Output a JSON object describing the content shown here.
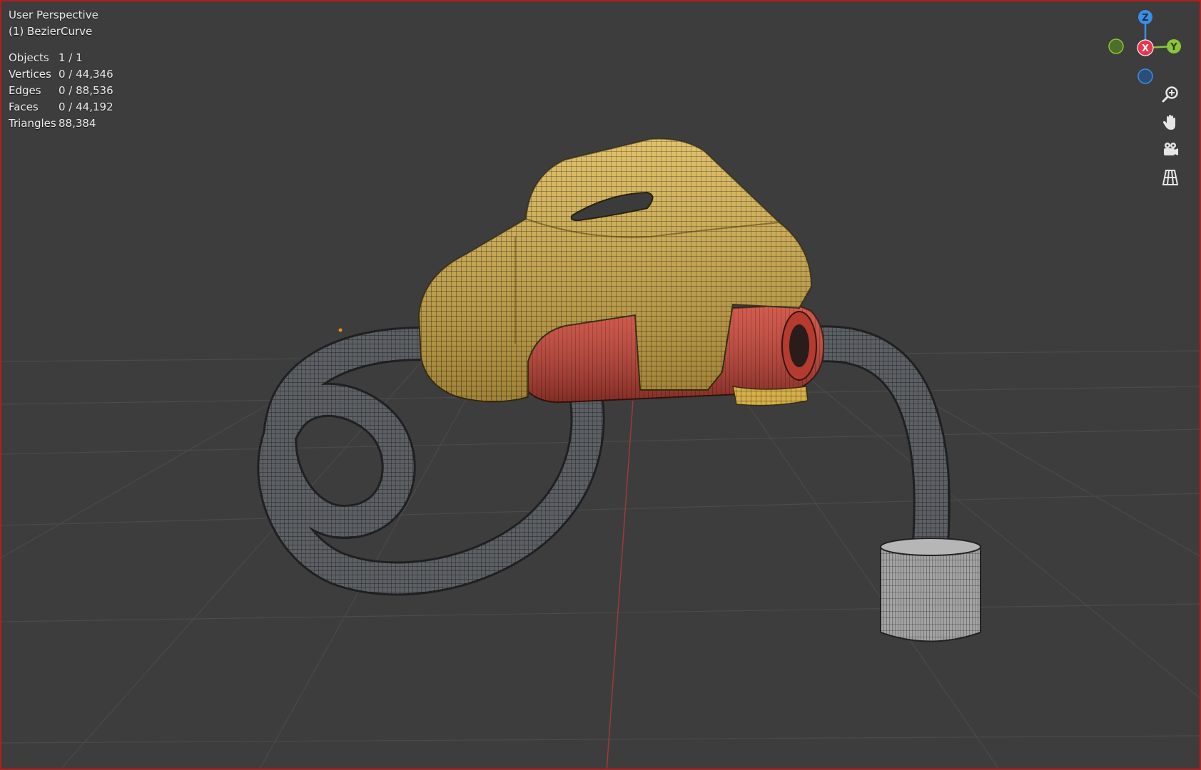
{
  "viewport": {
    "title": "User Perspective",
    "object": "(1) BezierCurve"
  },
  "stats": [
    {
      "label": "Objects",
      "value": "1 / 1"
    },
    {
      "label": "Vertices",
      "value": "0 / 44,346"
    },
    {
      "label": "Edges",
      "value": "0 / 88,536"
    },
    {
      "label": "Faces",
      "value": "0 / 44,192"
    },
    {
      "label": "Triangles",
      "value": "88,384"
    }
  ],
  "gizmo": {
    "z_label": "Z",
    "x_label": "X",
    "y_label": "Y",
    "colors": {
      "x": "#e8364f",
      "y": "#8ac43a",
      "z": "#3a8ee6"
    }
  },
  "nav_icons": [
    "zoom-icon",
    "hand-pan-icon",
    "camera-icon",
    "grid-view-icon"
  ],
  "colors": {
    "background": "#3d3d3d",
    "border": "#b81c1c",
    "body_yellow": "#d9b24a",
    "grip_red": "#c9463a",
    "hose_gray": "#5b5e62",
    "nozzle_gray": "#9c9c9c"
  }
}
